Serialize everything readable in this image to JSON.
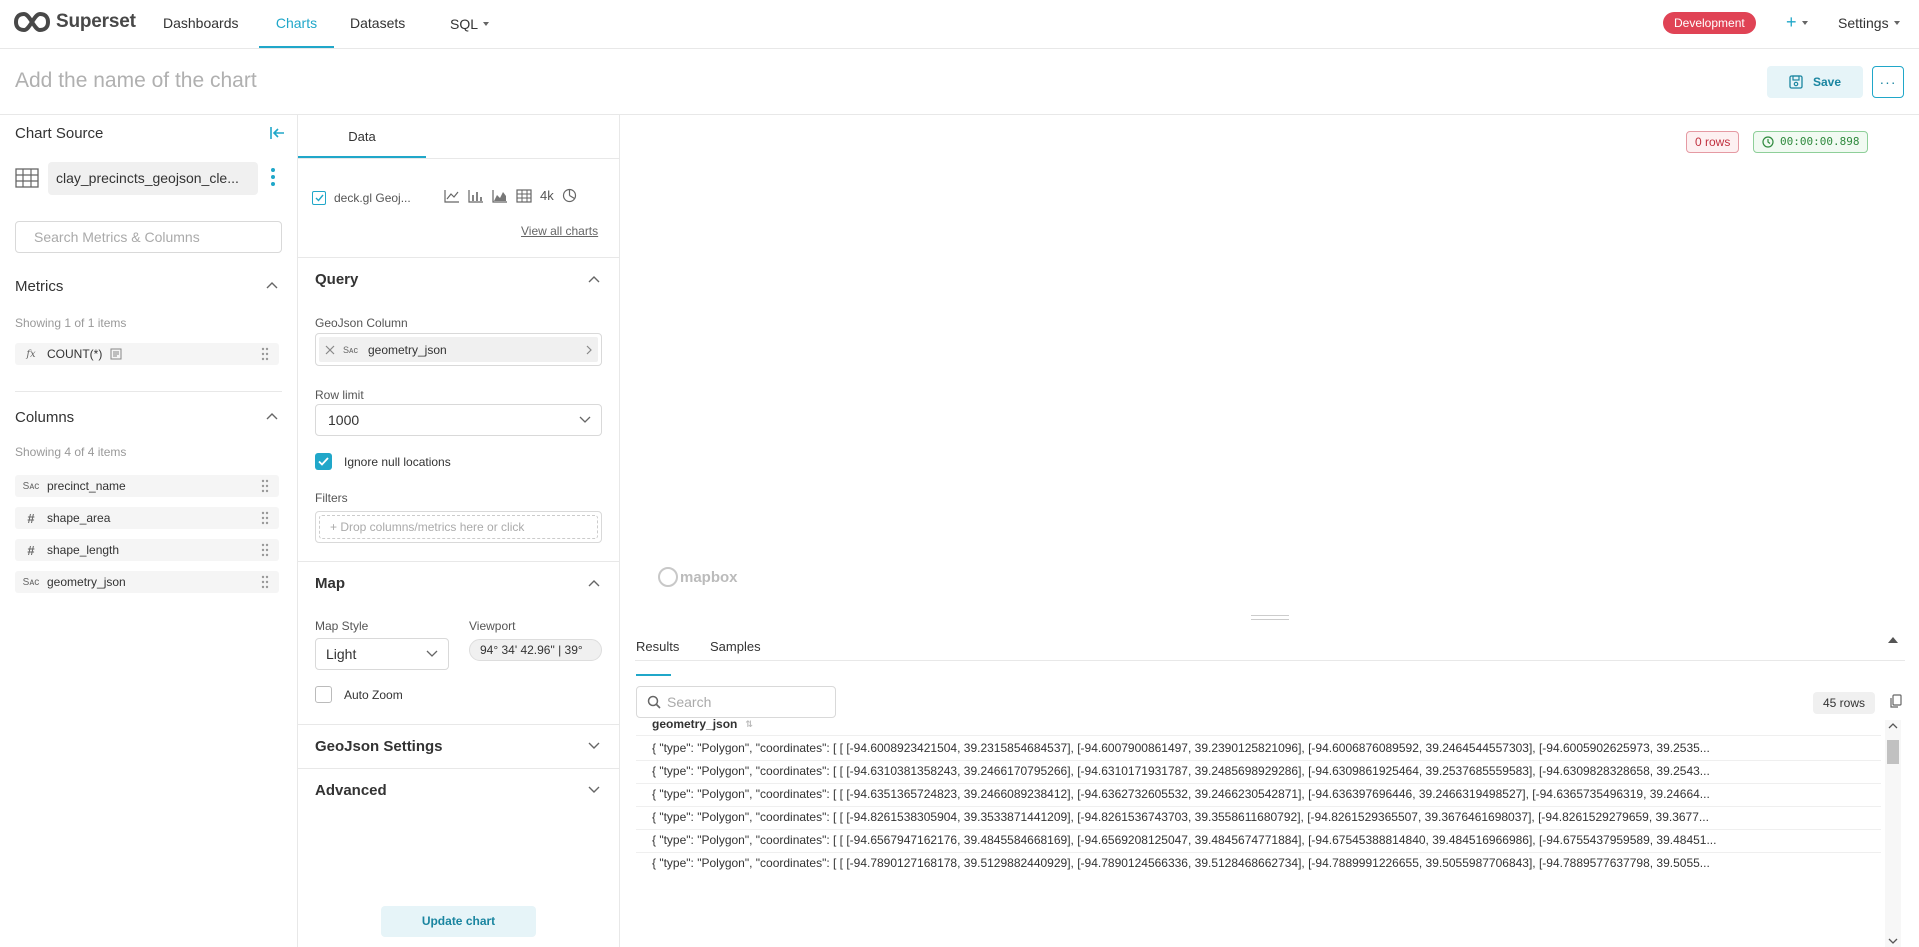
{
  "nav": {
    "brand": "Superset",
    "dashboards": "Dashboards",
    "charts": "Charts",
    "datasets": "Datasets",
    "sql": "SQL",
    "environment": "Development",
    "plus": "+",
    "settings": "Settings",
    "accent_color": "#20a7c9",
    "env_color": "#e04355"
  },
  "header": {
    "chart_name_placeholder": "Add the name of the chart",
    "save": "Save",
    "more": "···"
  },
  "datasource": {
    "title": "Chart Source",
    "name": "clay_precincts_geojson_cle...",
    "search_placeholder": "Search Metrics & Columns",
    "metrics_title": "Metrics",
    "metrics_count": "Showing 1 of 1 items",
    "metrics": [
      {
        "type": "fx",
        "name": "COUNT(*)"
      }
    ],
    "columns_title": "Columns",
    "columns_count": "Showing 4 of 4 items",
    "columns": [
      {
        "type": "string",
        "name": "precinct_name"
      },
      {
        "type": "numeric",
        "name": "shape_area"
      },
      {
        "type": "numeric",
        "name": "shape_length"
      },
      {
        "type": "string",
        "name": "geometry_json"
      }
    ]
  },
  "controls": {
    "tab": "Data",
    "viz_type": "deck.gl Geoj...",
    "viz_extra": "4k",
    "view_all": "View all charts",
    "query_title": "Query",
    "geojson_label": "GeoJson Column",
    "geojson_value": "geometry_json",
    "row_limit_label": "Row limit",
    "row_limit_value": "1000",
    "ignore_null_label": "Ignore null locations",
    "filters_label": "Filters",
    "filters_placeholder": "+ Drop columns/metrics here or click",
    "map_title": "Map",
    "map_style_label": "Map Style",
    "map_style_value": "Light",
    "viewport_label": "Viewport",
    "viewport_value": "94° 34' 42.96\" | 39°",
    "auto_zoom_label": "Auto Zoom",
    "geojson_settings_title": "GeoJson Settings",
    "advanced_title": "Advanced",
    "update": "Update chart"
  },
  "chart": {
    "rows_badge": "0 rows",
    "timer": "00:00:00.898",
    "mapbox": "mapbox"
  },
  "results": {
    "tab_results": "Results",
    "tab_samples": "Samples",
    "search_placeholder": "Search",
    "row_count": "45 rows",
    "column": "geometry_json",
    "rows": [
      "{ \"type\": \"Polygon\", \"coordinates\": [ [ [-94.6008923421504, 39.2315854684537], [-94.6007900861497, 39.2390125821096], [-94.6006876089592, 39.2464544557303], [-94.6005902625973, 39.2535...",
      "{ \"type\": \"Polygon\", \"coordinates\": [ [ [-94.6310381358243, 39.2466170795266], [-94.6310171931787, 39.2485698929286], [-94.6309861925464, 39.2537685559583], [-94.6309828328658, 39.2543...",
      "{ \"type\": \"Polygon\", \"coordinates\": [ [ [-94.6351365724823, 39.2466089238412], [-94.6362732605532, 39.2466230542871], [-94.636397696446, 39.2466319498527], [-94.6365735496319, 39.24664...",
      "{ \"type\": \"Polygon\", \"coordinates\": [ [ [-94.8261538305904, 39.3533871441209], [-94.8261536743703, 39.3558611680792], [-94.8261529365507, 39.3676461698037], [-94.8261529279659, 39.3677...",
      "{ \"type\": \"Polygon\", \"coordinates\": [ [ [-94.6567947162176, 39.4845584668169], [-94.6569208125047, 39.4845674771884], [-94.67545388814840, 39.484516966986], [-94.6755437959589, 39.48451...",
      "{ \"type\": \"Polygon\", \"coordinates\": [ [ [-94.7890127168178, 39.5129882440929], [-94.7890124566336, 39.5128468662734], [-94.7889991226655, 39.5055987706843], [-94.7889577637798, 39.5055..."
    ]
  }
}
